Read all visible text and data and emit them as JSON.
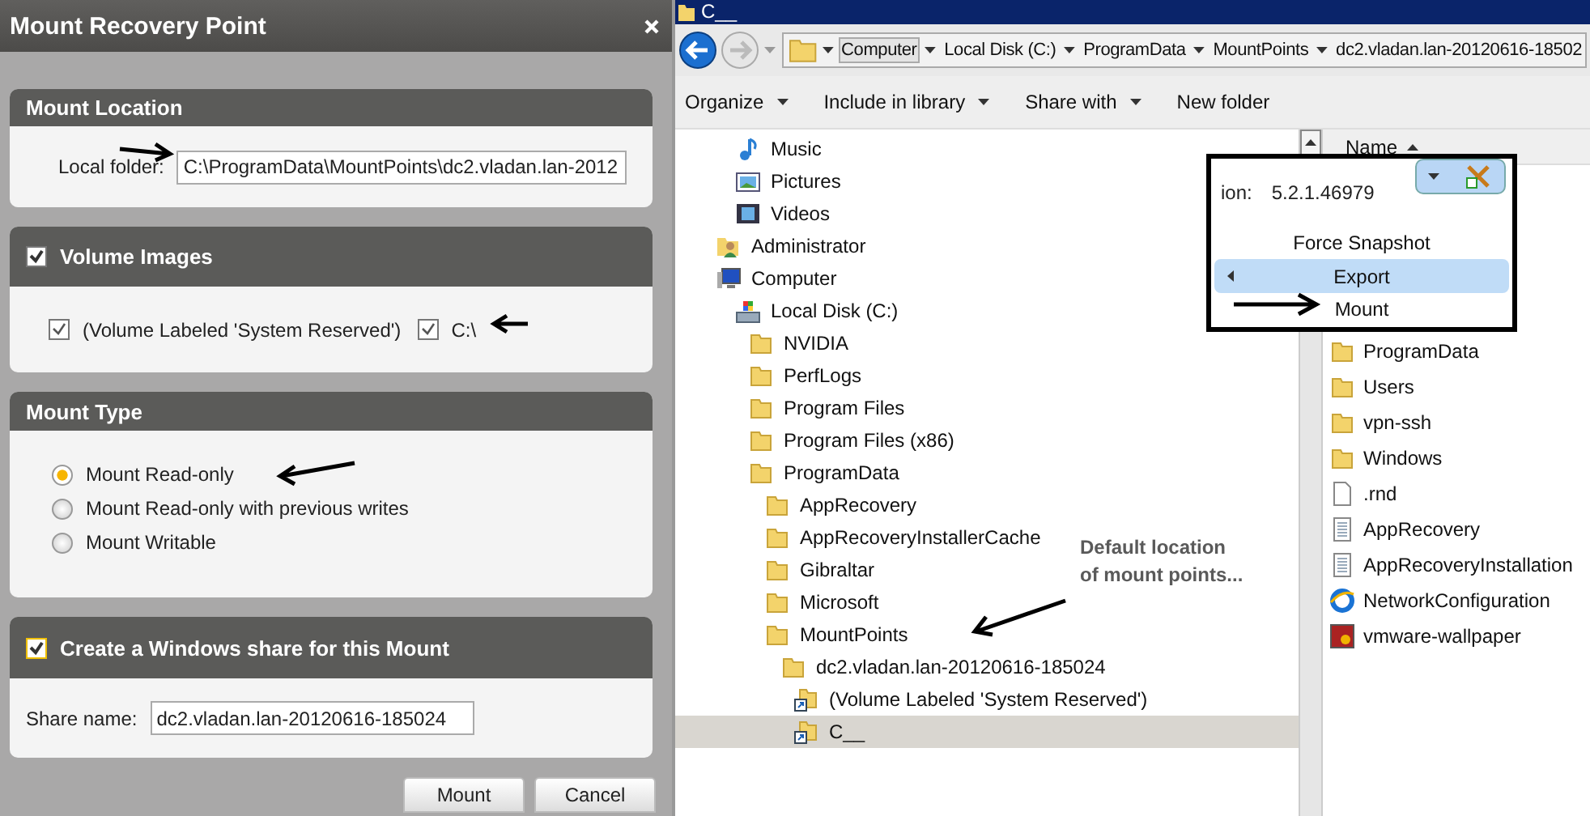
{
  "dialog": {
    "title": "Mount Recovery Point",
    "mount_location": {
      "heading": "Mount Location",
      "label": "Local folder:",
      "value": "C:\\ProgramData\\MountPoints\\dc2.vladan.lan-2012"
    },
    "volume_images": {
      "heading": "Volume Images",
      "checked": true,
      "items": [
        {
          "label": "(Volume Labeled 'System Reserved')",
          "checked": true
        },
        {
          "label": "C:\\",
          "checked": true
        }
      ]
    },
    "mount_type": {
      "heading": "Mount Type",
      "options": [
        {
          "label": "Mount Read-only",
          "selected": true
        },
        {
          "label": "Mount Read-only with previous writes",
          "selected": false
        },
        {
          "label": "Mount Writable",
          "selected": false
        }
      ]
    },
    "share": {
      "heading": "Create a Windows share for this Mount",
      "checked": true,
      "label": "Share name:",
      "value": "dc2.vladan.lan-20120616-185024"
    },
    "buttons": [
      "Mount",
      "Cancel"
    ]
  },
  "explorer": {
    "title": "C__",
    "breadcrumb": [
      "Computer",
      "Local Disk (C:)",
      "ProgramData",
      "MountPoints",
      "dc2.vladan.lan-20120616-18502"
    ],
    "toolbar": [
      {
        "label": "Organize",
        "dropdown": true
      },
      {
        "label": "Include in library",
        "dropdown": true
      },
      {
        "label": "Share with",
        "dropdown": true
      },
      {
        "label": "New folder",
        "dropdown": false
      }
    ],
    "tree": [
      {
        "label": "Music",
        "kind": "music",
        "selected": false
      },
      {
        "label": "Pictures",
        "kind": "pictures",
        "selected": false
      },
      {
        "label": "Videos",
        "kind": "videos",
        "selected": false
      },
      {
        "label": "Administrator",
        "kind": "user",
        "selected": false
      },
      {
        "label": "Computer",
        "kind": "computer",
        "selected": false,
        "children": [
          {
            "label": "Local Disk (C:)",
            "kind": "disk",
            "selected": false,
            "children": [
              {
                "label": "NVIDIA",
                "kind": "folder",
                "selected": false
              },
              {
                "label": "PerfLogs",
                "kind": "folder",
                "selected": false
              },
              {
                "label": "Program Files",
                "kind": "folder",
                "selected": false
              },
              {
                "label": "Program Files (x86)",
                "kind": "folder",
                "selected": false
              },
              {
                "label": "ProgramData",
                "kind": "folder",
                "selected": false,
                "children": [
                  {
                    "label": "AppRecovery",
                    "kind": "folder",
                    "selected": false
                  },
                  {
                    "label": "AppRecoveryInstallerCache",
                    "kind": "folder",
                    "selected": false
                  },
                  {
                    "label": "Gibraltar",
                    "kind": "folder",
                    "selected": false
                  },
                  {
                    "label": "Microsoft",
                    "kind": "folder",
                    "selected": false
                  },
                  {
                    "label": "MountPoints",
                    "kind": "folder",
                    "selected": false,
                    "children": [
                      {
                        "label": "dc2.vladan.lan-20120616-185024",
                        "kind": "folder",
                        "selected": false,
                        "children": [
                          {
                            "label": "(Volume Labeled 'System Reserved')",
                            "kind": "shortcut",
                            "selected": false
                          },
                          {
                            "label": "C__",
                            "kind": "shortcut",
                            "selected": true
                          }
                        ]
                      }
                    ]
                  }
                ]
              }
            ]
          }
        ]
      }
    ],
    "column_header": "Name",
    "files": [
      {
        "label": "ProgramData",
        "kind": "folder"
      },
      {
        "label": "Users",
        "kind": "folder"
      },
      {
        "label": "vpn-ssh",
        "kind": "folder"
      },
      {
        "label": "Windows",
        "kind": "folder"
      },
      {
        "label": ".rnd",
        "kind": "file"
      },
      {
        "label": "AppRecovery",
        "kind": "text"
      },
      {
        "label": "AppRecoveryInstallation",
        "kind": "text"
      },
      {
        "label": "NetworkConfiguration",
        "kind": "web"
      },
      {
        "label": "vmware-wallpaper",
        "kind": "image"
      }
    ],
    "popup": {
      "version_label": "ion:",
      "version": "5.2.1.46979",
      "menu": [
        {
          "label": "Force Snapshot",
          "selected": false,
          "submenu": false
        },
        {
          "label": "Export",
          "selected": true,
          "submenu": true
        },
        {
          "label": "Mount",
          "selected": false,
          "submenu": false
        }
      ]
    },
    "annotation": "Default location\nof mount points..."
  }
}
